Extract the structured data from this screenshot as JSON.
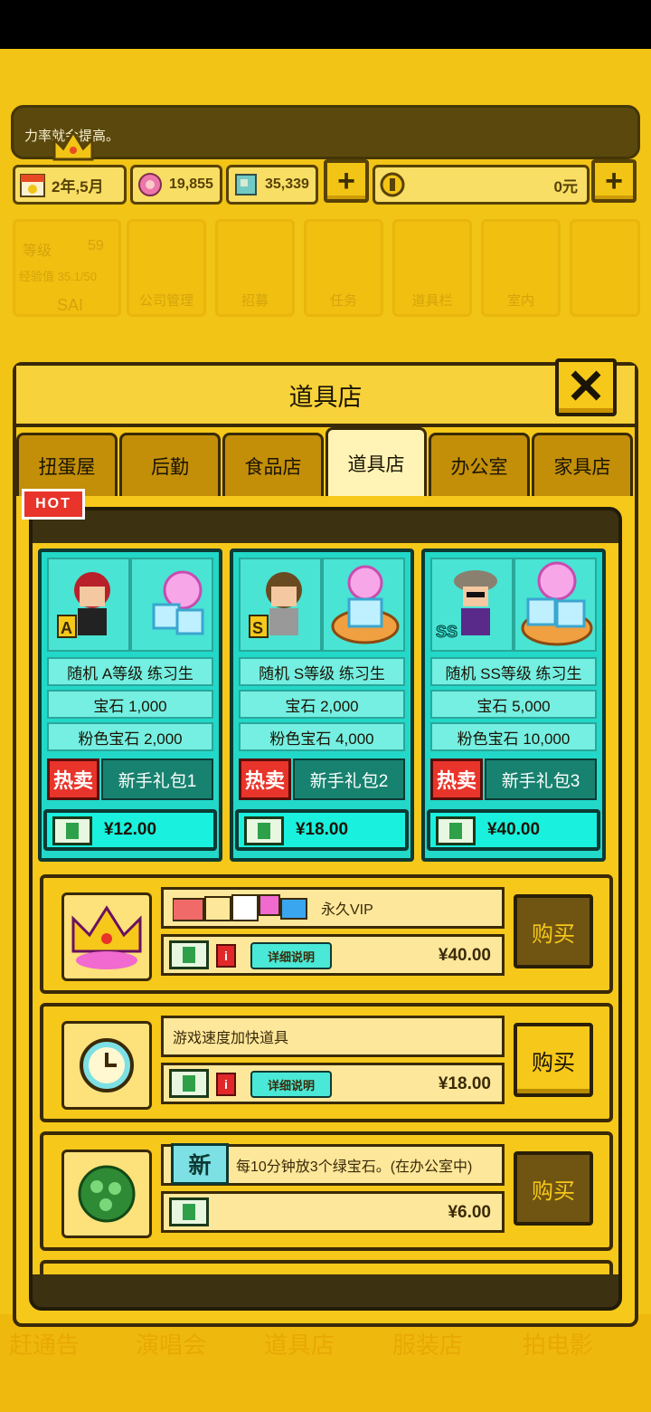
{
  "message": "力率就会提高。",
  "resources": {
    "date": "2年,5月",
    "pink_gems": "19,855",
    "blue_gems": "35,339",
    "money": "0元",
    "plus": "+"
  },
  "bg_menu": {
    "level_label": "等级",
    "level_value": "59",
    "exp_label": "经验值 35.1/50",
    "name": "SAI",
    "items": [
      "公司管理",
      "招募",
      "任务",
      "道具栏",
      "室内"
    ],
    "bottom": [
      "赶通告",
      "演唱会",
      "道具店",
      "服装店",
      "拍电影"
    ]
  },
  "modal": {
    "title": "道具店",
    "close": "X",
    "tabs": [
      "扭蛋屋",
      "后勤",
      "食品店",
      "道具店",
      "办公室",
      "家具店"
    ],
    "active_tab": 3
  },
  "packs": [
    {
      "title": "随机 A等级 练习生",
      "gem": "宝石 1,000",
      "pink": "粉色宝石 2,000",
      "hot": "热卖",
      "name": "新手礼包1",
      "price": "¥12.00",
      "grade": "A"
    },
    {
      "title": "随机 S等级 练习生",
      "gem": "宝石 2,000",
      "pink": "粉色宝石 4,000",
      "hot": "热卖",
      "name": "新手礼包2",
      "price": "¥18.00",
      "grade": "S"
    },
    {
      "title": "随机 SS等级 练习生",
      "gem": "宝石 5,000",
      "pink": "粉色宝石 10,000",
      "hot": "热卖",
      "name": "新手礼包3",
      "price": "¥40.00",
      "grade": "SS"
    }
  ],
  "items": [
    {
      "name": "永久VIP",
      "price": "¥40.00",
      "info": "详细说明",
      "buy": "购买",
      "hot_flag": "HOT"
    },
    {
      "name": "游戏速度加快道具",
      "price": "¥18.00",
      "info": "详细说明",
      "buy": "购买"
    },
    {
      "name": "每10分钟放3个绿宝石。(在办公室中)",
      "price": "¥6.00",
      "new": "新",
      "buy": "购买"
    }
  ],
  "colors": {
    "accent": "#f6c81a",
    "teal": "#22d8c8",
    "hot_red": "#e8342a",
    "dark": "#3a2a08"
  }
}
